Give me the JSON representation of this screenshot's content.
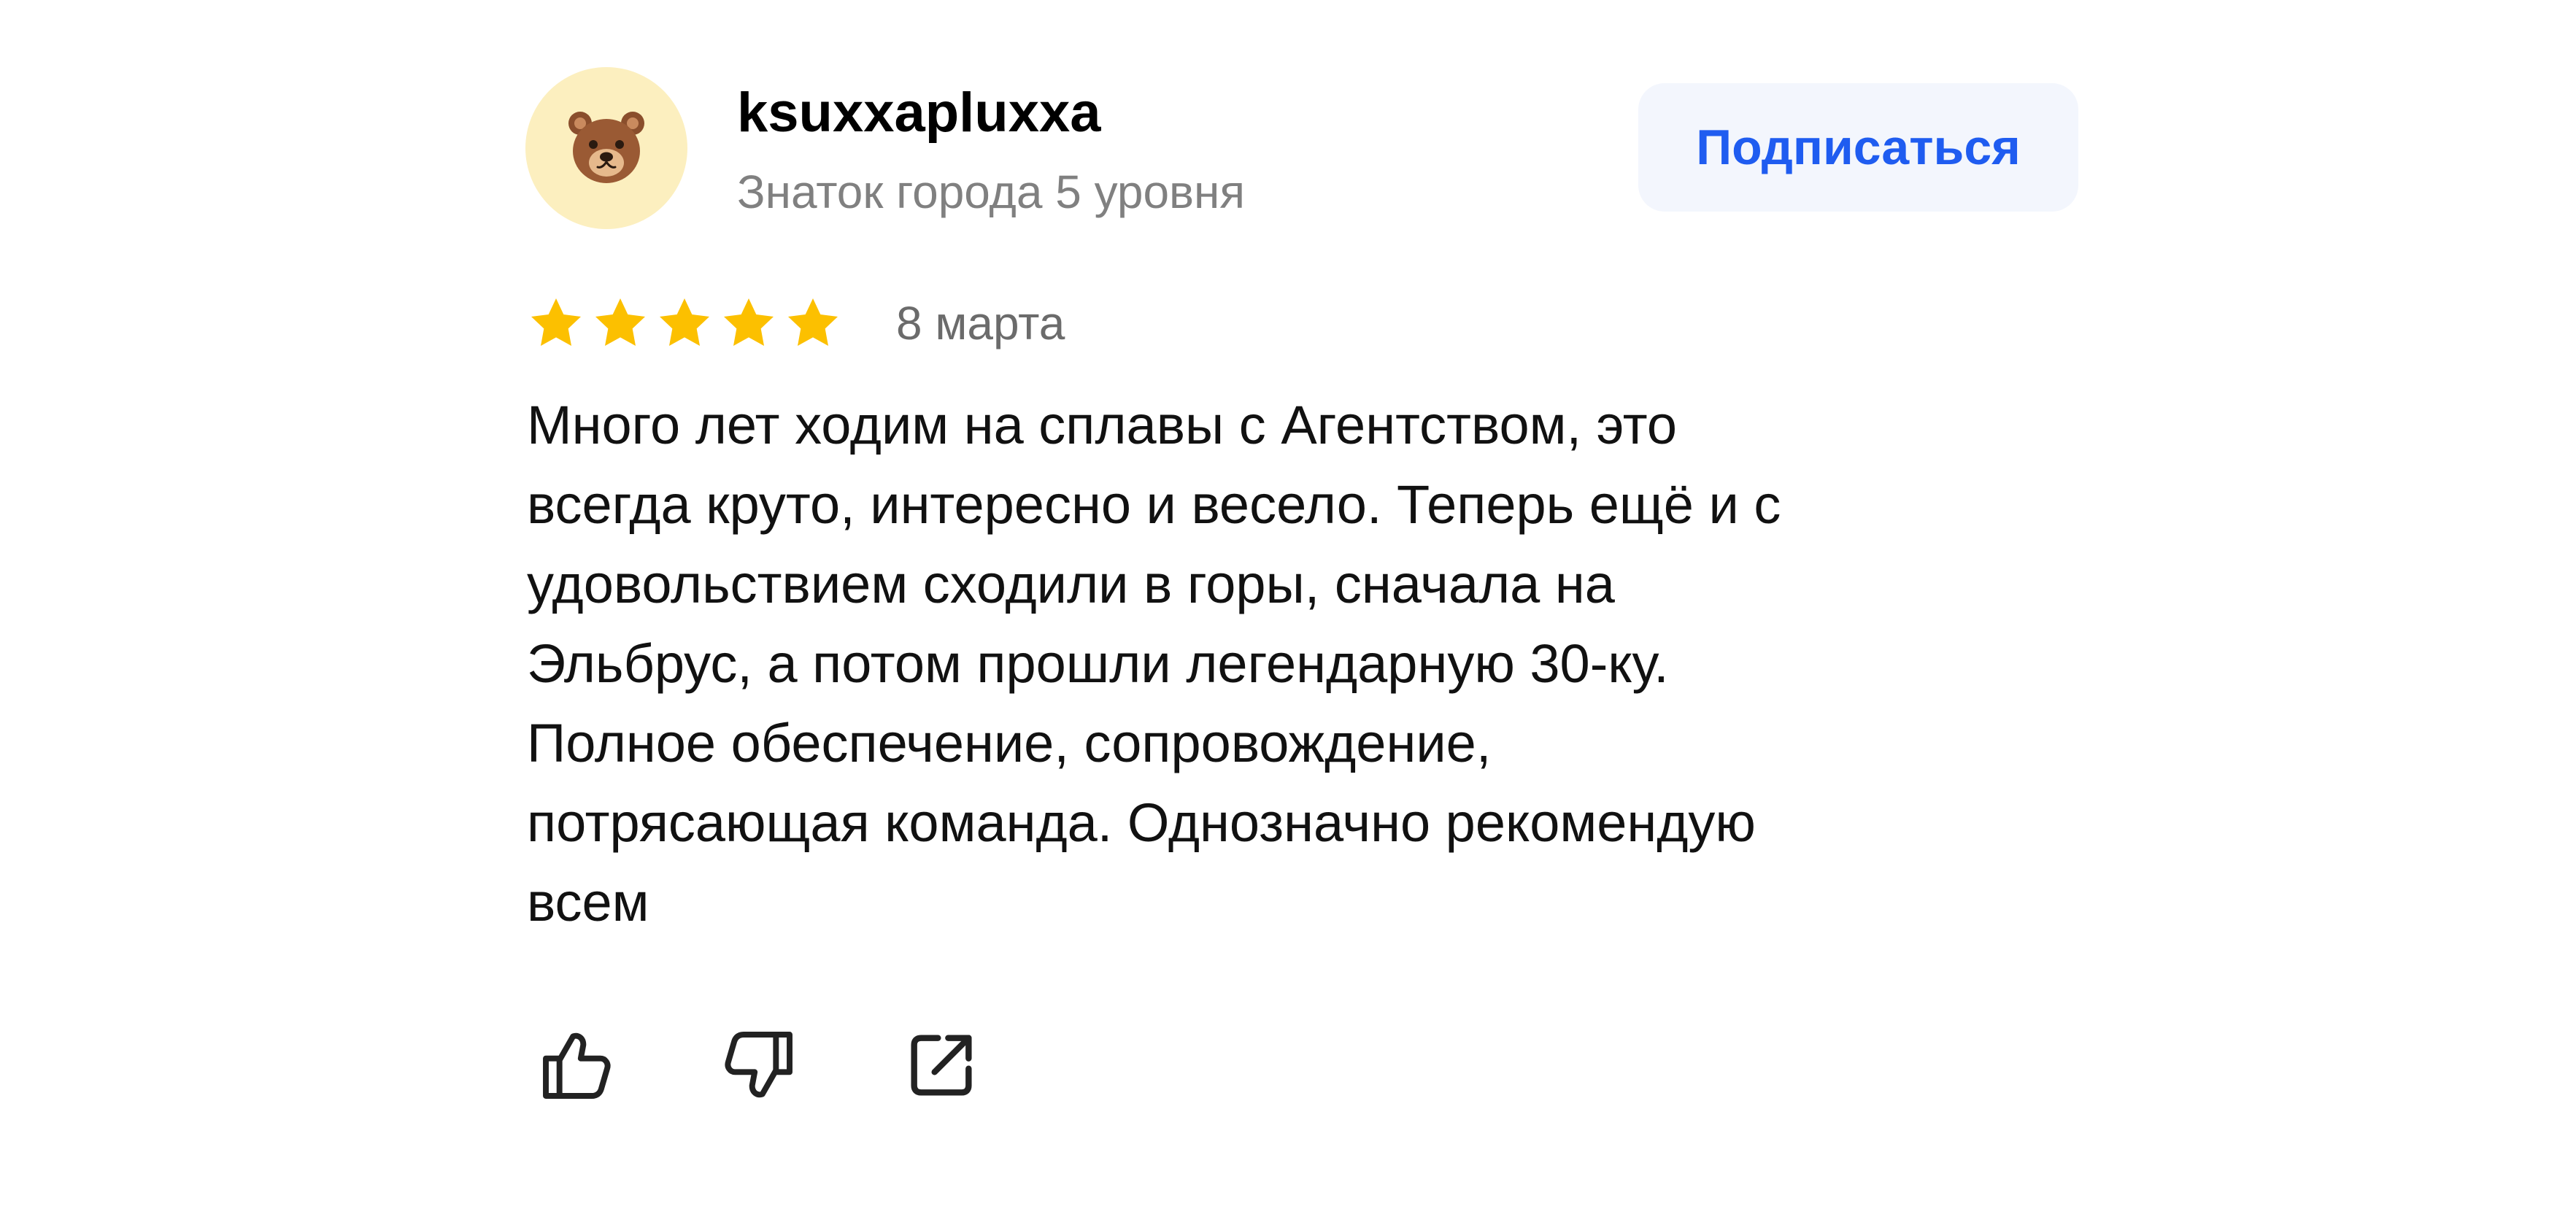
{
  "user": {
    "avatar_icon": "bear-face-icon",
    "name": "ksuxxapluxxa",
    "level": "Знаток города 5 уровня"
  },
  "subscribe": {
    "label": "Подписаться",
    "color": "#1f5cf0",
    "background": "#f3f6fd"
  },
  "review": {
    "rating": 5,
    "rating_max": 5,
    "star_color": "#fcc000",
    "date": "8 марта",
    "lines": [
      "Много лет ходим на сплавы с Агентством, это",
      "всегда круто, интересно и весело. Теперь ещё и с",
      "удовольствием сходили в горы, сначала на",
      "Эльбрус, а потом прошли легендарную 30-ку.",
      "Полное обеспечение, сопровождение,",
      "потрясающая команда. Однозначно рекомендую",
      "всем"
    ]
  },
  "actions": [
    {
      "icon": "thumbs-up-icon"
    },
    {
      "icon": "thumbs-down-icon"
    },
    {
      "icon": "share-icon"
    }
  ]
}
